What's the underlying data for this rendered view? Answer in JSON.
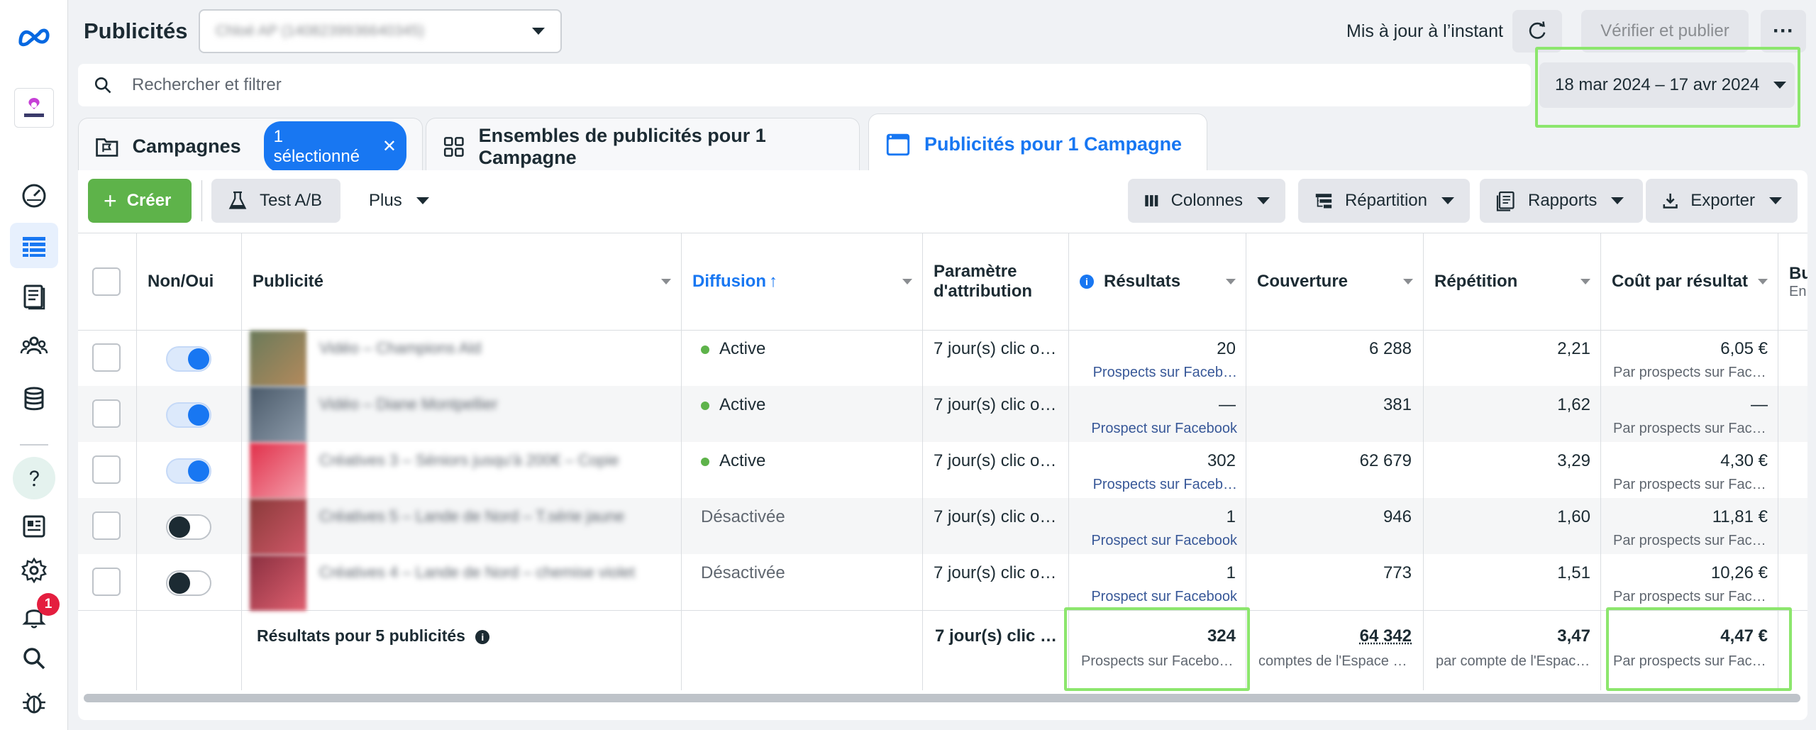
{
  "header": {
    "title": "Publicités",
    "account": "Chloé AP (1408239936640345)",
    "updated": "Mis à jour à l’instant",
    "publish_label": "Vérifier et publier",
    "more_label": "···"
  },
  "rail": {
    "notification_count": "1"
  },
  "search": {
    "placeholder": "Rechercher et filtrer",
    "date_range": "18 mar 2024 – 17 avr 2024"
  },
  "tabs": {
    "campaigns": "Campagnes",
    "selected_pill": "1 sélectionné",
    "adsets": "Ensembles de publicités pour 1 Campagne",
    "ads": "Publicités pour 1 Campagne"
  },
  "toolbar": {
    "create": "Créer",
    "ab_test": "Test A/B",
    "more": "Plus",
    "columns": "Colonnes",
    "breakdown": "Répartition",
    "reports": "Rapports",
    "export": "Exporter"
  },
  "table": {
    "headers": {
      "onoff": "Non/Oui",
      "ad": "Publicité",
      "delivery": "Diffusion",
      "attribution_1": "Paramètre",
      "attribution_2": "d'attribution",
      "results": "Résultats",
      "reach": "Couverture",
      "frequency": "Répétition",
      "cpr": "Coût par résultat",
      "next_1": "Bu",
      "next_2": "En"
    },
    "rows": [
      {
        "name": "Vidéo – Champions Ald",
        "on": true,
        "delivery": "Active",
        "attribution": "7 jour(s) clic o…",
        "results": "20",
        "results_sub": "Prospects sur Faceb…",
        "reach": "6 288",
        "frequency": "2,21",
        "cpr": "6,05 €",
        "cpr_sub": "Par prospects sur Fac…"
      },
      {
        "name": "Vidéo – Diane Montpellier",
        "on": true,
        "delivery": "Active",
        "attribution": "7 jour(s) clic o…",
        "results": "—",
        "results_sub": "Prospect sur Facebook",
        "reach": "381",
        "frequency": "1,62",
        "cpr": "—",
        "cpr_sub": "Par prospects sur Fac…"
      },
      {
        "name": "Créatives 3 – Séniors jusqu'à 200€ – Copie",
        "on": true,
        "delivery": "Active",
        "attribution": "7 jour(s) clic o…",
        "results": "302",
        "results_sub": "Prospects sur Faceb…",
        "reach": "62 679",
        "frequency": "3,29",
        "cpr": "4,30 €",
        "cpr_sub": "Par prospects sur Fac…"
      },
      {
        "name": "Créatives 5 – Lande de Nord – T.série jaune",
        "on": false,
        "delivery": "Désactivée",
        "attribution": "7 jour(s) clic o…",
        "results": "1",
        "results_sub": "Prospect sur Facebook",
        "reach": "946",
        "frequency": "1,60",
        "cpr": "11,81 €",
        "cpr_sub": "Par prospects sur Fac…"
      },
      {
        "name": "Créatives 4 – Lande de Nord – chemise violet",
        "on": false,
        "delivery": "Désactivée",
        "attribution": "7 jour(s) clic o…",
        "results": "1",
        "results_sub": "Prospect sur Facebook",
        "reach": "773",
        "frequency": "1,51",
        "cpr": "10,26 €",
        "cpr_sub": "Par prospects sur Fac…"
      }
    ],
    "totals": {
      "label": "Résultats pour 5 publicités",
      "attribution": "7 jour(s) clic o…",
      "results": "324",
      "results_sub": "Prospects sur Facebo…",
      "reach": "64 342",
      "reach_sub": "comptes de l'Espace …",
      "frequency": "3,47",
      "frequency_sub": "par compte de l'Espac…",
      "cpr": "4,47 €",
      "cpr_sub": "Par prospects sur Fac…"
    }
  },
  "colors": {
    "accent": "#1877f2",
    "create_green": "#5eb34a",
    "highlight": "#8ce66d"
  }
}
